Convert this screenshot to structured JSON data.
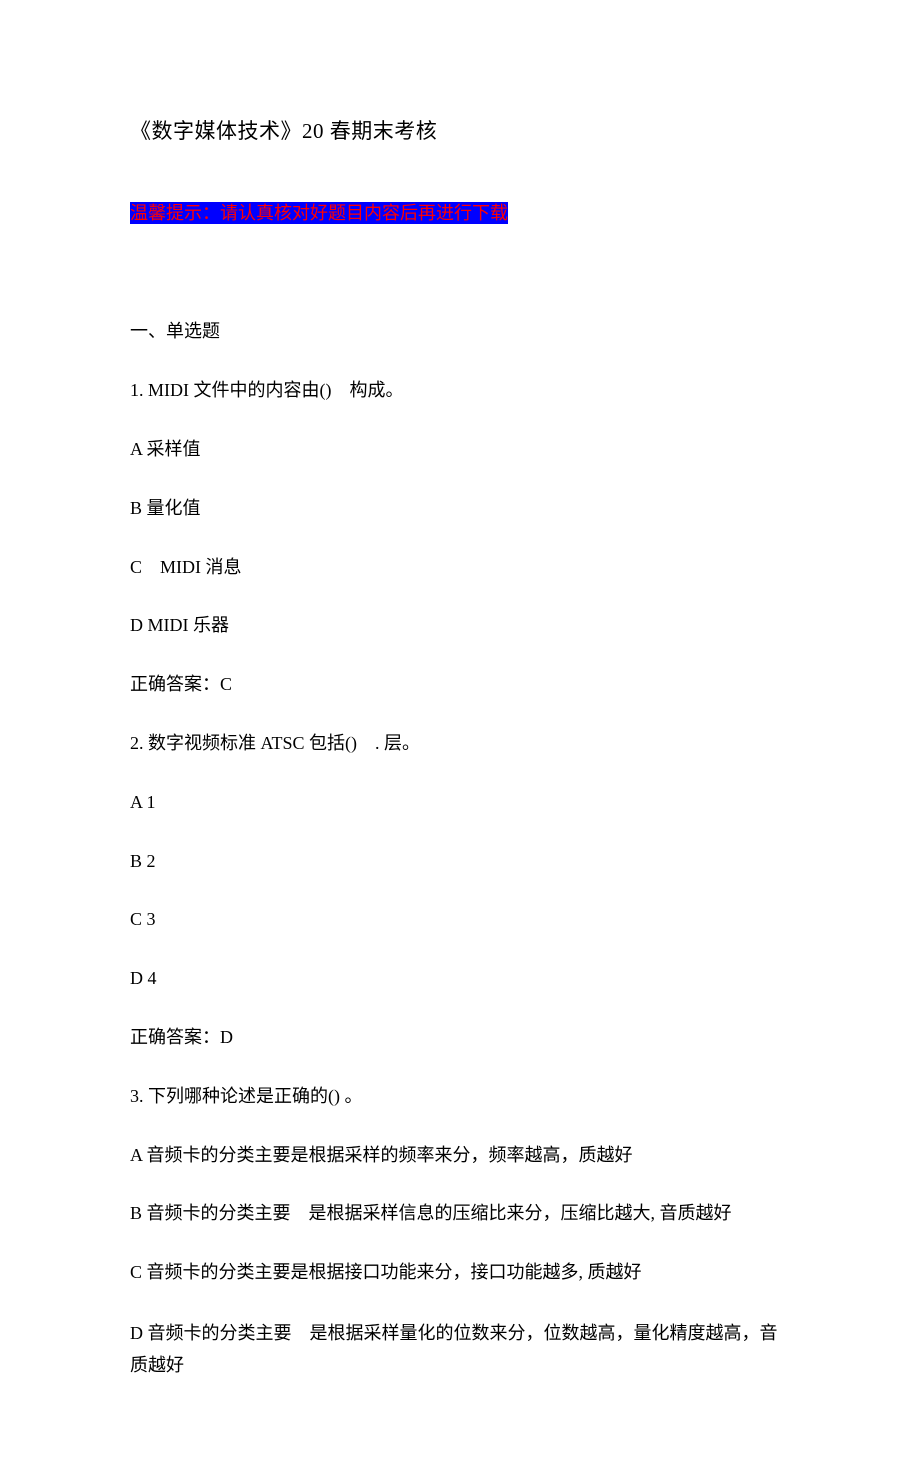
{
  "title": "《数字媒体技术》20 春期末考核",
  "notice": "温馨提示：请认真核对好题目内容后再进行下载",
  "section1": {
    "header": "一、单选题",
    "q1": {
      "question": "1. MIDI 文件中的内容由()　构成。",
      "optA": "A 采样值",
      "optB": "B 量化值",
      "optC": "C　MIDI 消息",
      "optD": "D MIDI 乐器",
      "answer": "正确答案：C"
    },
    "q2": {
      "question": "2. 数字视频标准 ATSC 包括()　. 层。",
      "optA": "A 1",
      "optB": "B 2",
      "optC": "C 3",
      "optD": "D 4",
      "answer": "正确答案：D"
    },
    "q3": {
      "question": "3. 下列哪种论述是正确的() 。",
      "optA": "A 音频卡的分类主要是根据采样的频率来分，频率越高，质越好",
      "optB": "B 音频卡的分类主要　是根据采样信息的压缩比来分，压缩比越大, 音质越好",
      "optC": "C 音频卡的分类主要是根据接口功能来分，接口功能越多, 质越好",
      "optD": "D 音频卡的分类主要　是根据采样量化的位数来分，位数越高，量化精度越高，音质越好"
    }
  }
}
